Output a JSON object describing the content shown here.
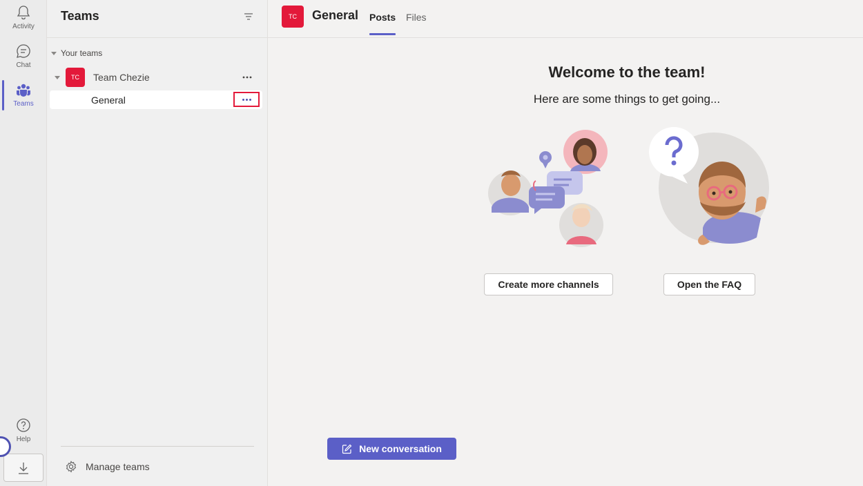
{
  "rail": {
    "items": [
      {
        "label": "Activity",
        "icon": "bell-icon"
      },
      {
        "label": "Chat",
        "icon": "chat-icon"
      },
      {
        "label": "Teams",
        "icon": "teams-icon"
      }
    ],
    "help": {
      "label": "Help",
      "icon": "help-icon"
    },
    "download_icon": "download-icon"
  },
  "panel": {
    "title": "Teams",
    "section_label": "Your teams",
    "team": {
      "avatar": "TC",
      "name": "Team Chezie"
    },
    "channel": {
      "name": "General"
    },
    "manage_label": "Manage teams"
  },
  "main": {
    "avatar": "TC",
    "channel_title": "General",
    "tabs": [
      {
        "label": "Posts"
      },
      {
        "label": "Files"
      }
    ],
    "welcome_title": "Welcome to the team!",
    "welcome_subtitle": "Here are some things to get going...",
    "create_channels_label": "Create more channels",
    "faq_label": "Open the FAQ",
    "new_conversation_label": "New conversation"
  },
  "colors": {
    "accent": "#5b5fc7",
    "team_avatar": "#e3193a"
  }
}
